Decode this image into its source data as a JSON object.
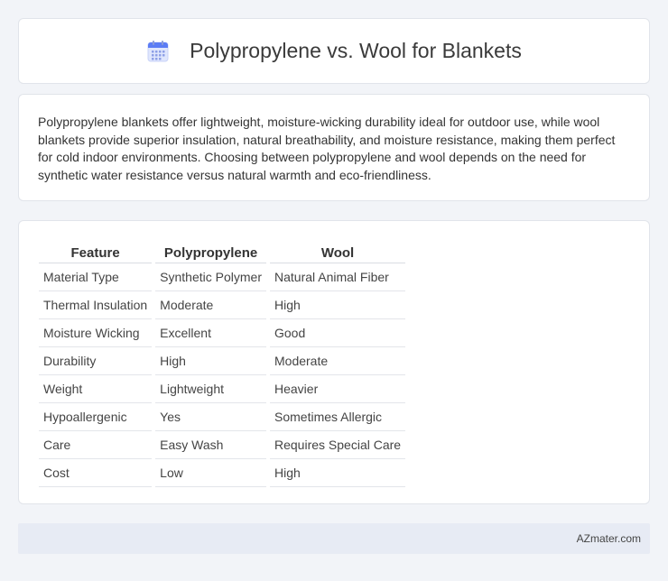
{
  "header": {
    "title": "Polypropylene vs. Wool for Blankets",
    "icon": "calendar-icon",
    "accent": "#5b7cf5"
  },
  "description": "Polypropylene blankets offer lightweight, moisture-wicking durability ideal for outdoor use, while wool blankets provide superior insulation, natural breathability, and moisture resistance, making them perfect for cold indoor environments. Choosing between polypropylene and wool depends on the need for synthetic water resistance versus natural warmth and eco-friendliness.",
  "table": {
    "headers": [
      "Feature",
      "Polypropylene",
      "Wool"
    ],
    "rows": [
      [
        "Material Type",
        "Synthetic Polymer",
        "Natural Animal Fiber"
      ],
      [
        "Thermal Insulation",
        "Moderate",
        "High"
      ],
      [
        "Moisture Wicking",
        "Excellent",
        "Good"
      ],
      [
        "Durability",
        "High",
        "Moderate"
      ],
      [
        "Weight",
        "Lightweight",
        "Heavier"
      ],
      [
        "Hypoallergenic",
        "Yes",
        "Sometimes Allergic"
      ],
      [
        "Care",
        "Easy Wash",
        "Requires Special Care"
      ],
      [
        "Cost",
        "Low",
        "High"
      ]
    ]
  },
  "footer": {
    "brand": "AZmater.com"
  }
}
